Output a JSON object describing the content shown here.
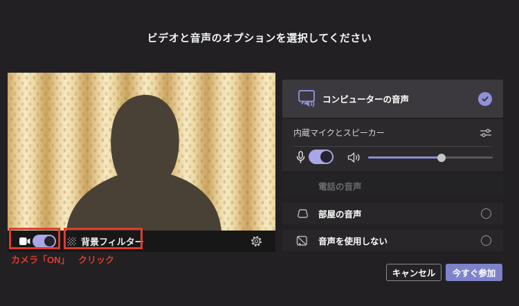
{
  "title": "ビデオと音声のオプションを選択してください",
  "annotations": {
    "camera_on_label": "カメラ「ON」",
    "click_label": "クリック",
    "highlight_color": "#e13b2e"
  },
  "video_preview": {
    "camera_toggle_state": "on",
    "background_filter_label": "背景フィルター",
    "gear_icon": "settings-gear"
  },
  "audio_panel": {
    "computer_audio": {
      "label": "コンピューターの音声",
      "selected": true
    },
    "device_section": {
      "label": "内蔵マイクとスピーカー",
      "mic_toggle_state": "on",
      "volume_percent": 59
    },
    "phone_audio": {
      "label": "電話の音声",
      "disabled": true
    },
    "room_audio": {
      "label": "部屋の音声",
      "selected": false
    },
    "no_audio": {
      "label": "音声を使用しない",
      "selected": false
    }
  },
  "footer": {
    "cancel_label": "キャンセル",
    "join_label": "今すぐ参加"
  },
  "colors": {
    "accent_purple": "#7e83c9",
    "toggle_purple": "#a9a7e6",
    "check_purple": "#8f92d8",
    "annotation_red": "#e13b2e",
    "background": "#222023"
  }
}
